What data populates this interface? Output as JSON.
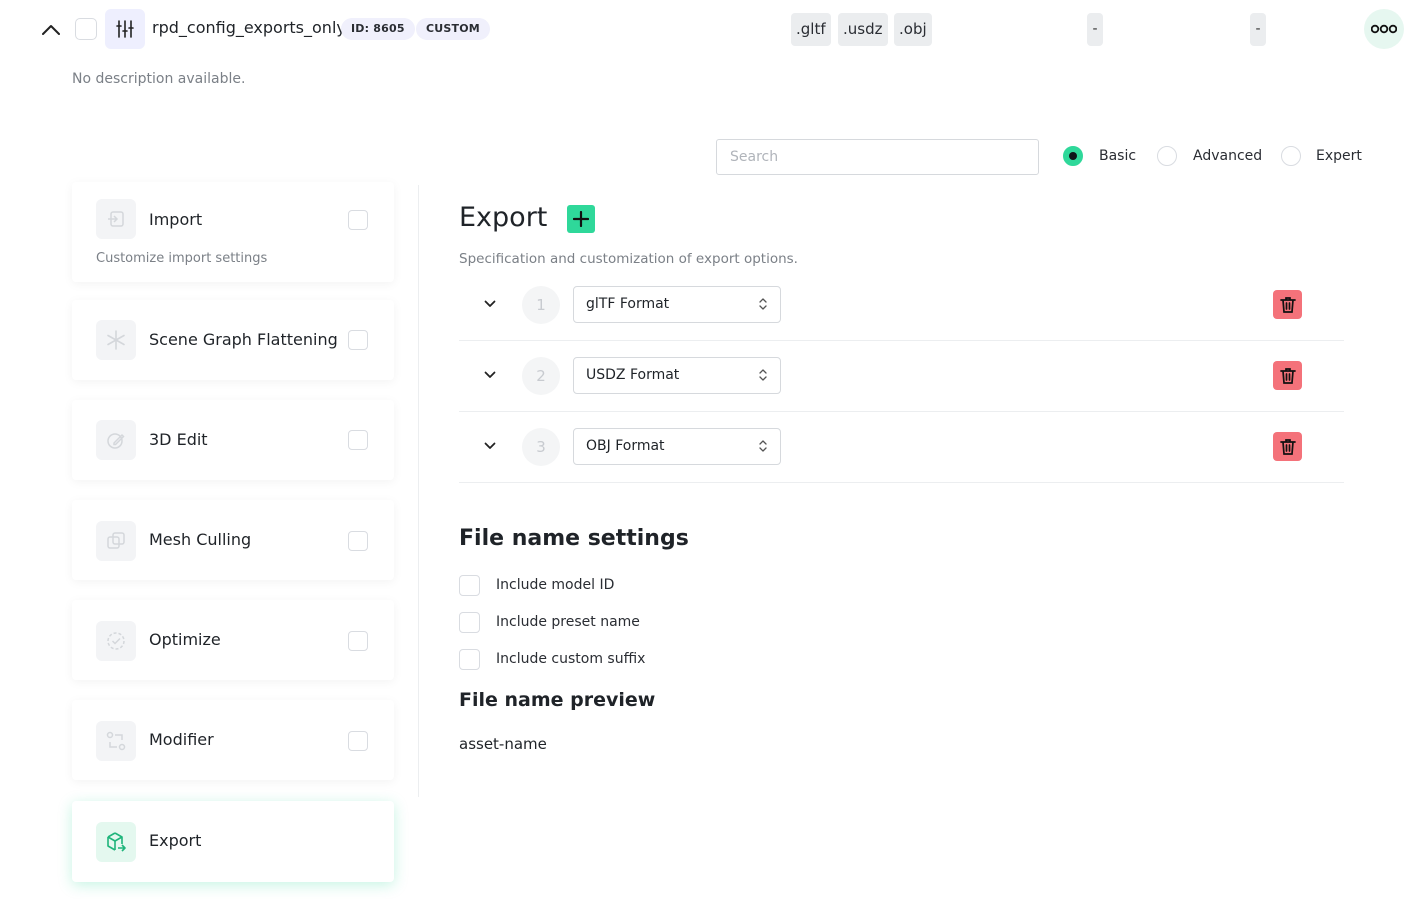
{
  "config": {
    "name": "rpd_config_exports_only",
    "id_label": "ID: 8605",
    "tag": "CUSTOM",
    "description": "No description available.",
    "formats": [
      ".gltf",
      ".usdz",
      ".obj"
    ],
    "col_a": "-",
    "col_b": "-"
  },
  "search": {
    "placeholder": "Search"
  },
  "modes": {
    "selected": "Basic",
    "options": [
      "Basic",
      "Advanced",
      "Expert"
    ]
  },
  "sidebar": {
    "items": [
      {
        "label": "Import",
        "subtitle": "Customize import settings",
        "icon": "import-icon"
      },
      {
        "label": "Scene Graph Flattening",
        "icon": "snowflake-icon"
      },
      {
        "label": "3D Edit",
        "icon": "edit-icon"
      },
      {
        "label": "Mesh Culling",
        "icon": "copy-icon"
      },
      {
        "label": "Optimize",
        "icon": "check-circle-icon"
      },
      {
        "label": "Modifier",
        "icon": "swap-icon"
      },
      {
        "label": "Export",
        "icon": "box-export-icon",
        "active": true
      }
    ]
  },
  "export": {
    "title": "Export",
    "subtitle": "Specification and customization of export options.",
    "rows": [
      {
        "index": "1",
        "format": "glTF Format"
      },
      {
        "index": "2",
        "format": "USDZ Format"
      },
      {
        "index": "3",
        "format": "OBJ Format"
      }
    ]
  },
  "file_name_settings": {
    "title": "File name settings",
    "options": [
      "Include model ID",
      "Include preset name",
      "Include custom suffix"
    ]
  },
  "file_name_preview": {
    "title": "File name preview",
    "value": "asset-name"
  },
  "colors": {
    "accent": "#2fd89a",
    "danger": "#f4727a",
    "tag_bg": "#f0f0fc"
  }
}
